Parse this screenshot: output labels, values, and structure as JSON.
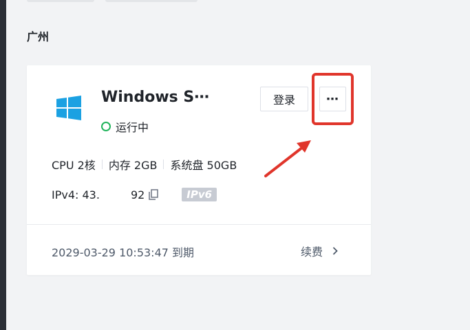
{
  "region": {
    "title": "广州"
  },
  "card": {
    "name": "Windows S⋯",
    "status": "运行中",
    "buttons": {
      "login": "登录",
      "more": "⋯"
    },
    "specs": {
      "cpu": "CPU 2核",
      "memory": "内存 2GB",
      "disk": "系统盘 50GB"
    },
    "ip": {
      "prefix": "IPv4: 43.",
      "suffix": "92",
      "ipv6_badge": "IPv6"
    },
    "expire": "2029-03-29 10:53:47 到期",
    "renew": "续费"
  },
  "colors": {
    "accent_red": "#e0352b",
    "status_green": "#1fb35a",
    "windows_blue": "#1ba1e2"
  }
}
